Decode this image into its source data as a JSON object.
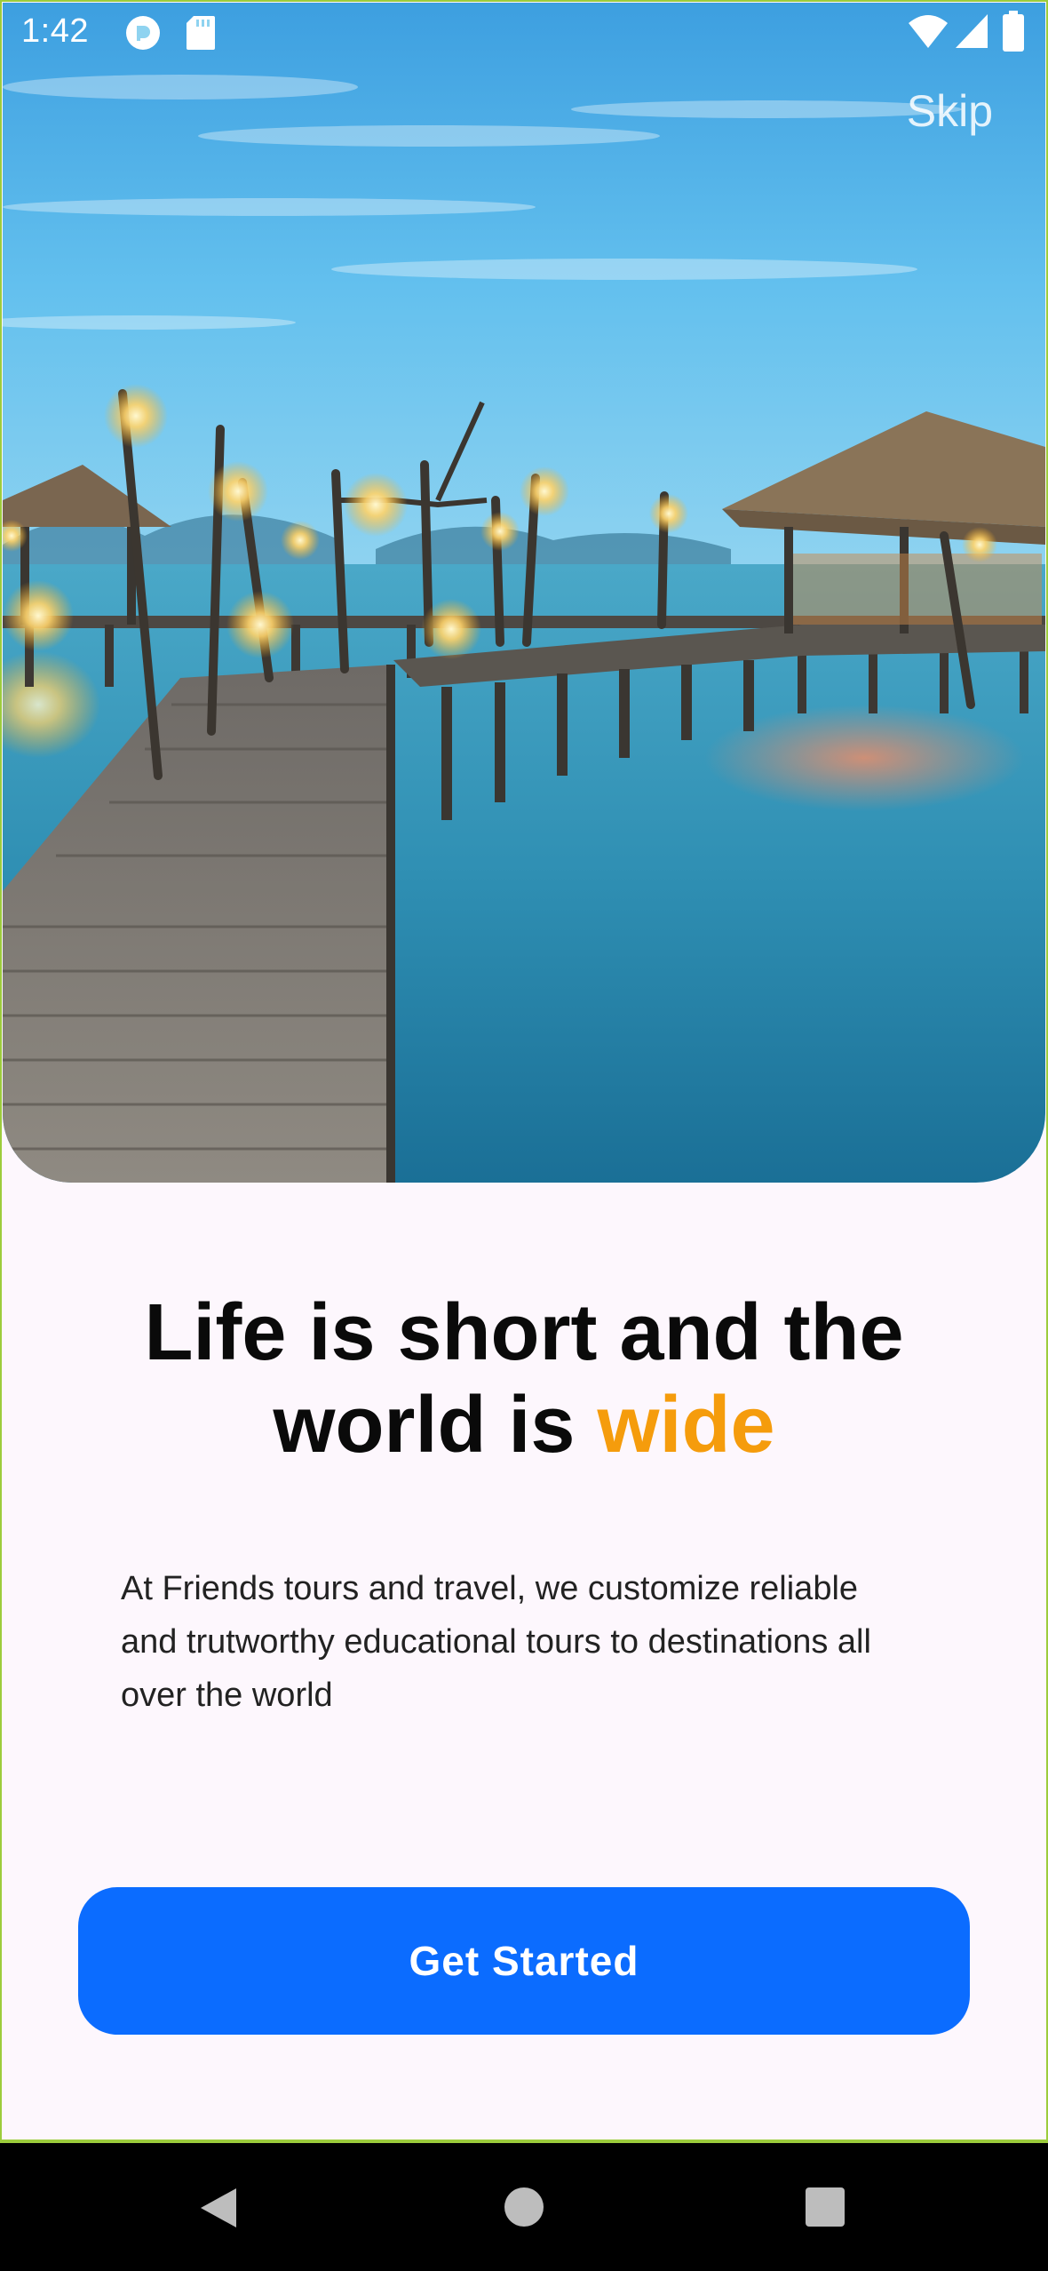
{
  "status_bar": {
    "time": "1:42",
    "icons": [
      "app-notification-icon",
      "sd-card-icon",
      "wifi-icon",
      "signal-icon",
      "battery-icon"
    ]
  },
  "header": {
    "skip_label": "Skip"
  },
  "hero": {
    "image_subject": "wooden pier leading to thatched huts over water at dusk with string lights"
  },
  "content": {
    "headline_line1": "Life is short and the",
    "headline_line2_prefix": "world is ",
    "headline_accent": "wide",
    "description": "At Friends tours and travel, we customize reliable and trutworthy educational tours to destinations all over the world"
  },
  "actions": {
    "get_started_label": "Get Started"
  },
  "navigation": {
    "buttons": [
      "back-icon",
      "home-icon",
      "recents-icon"
    ]
  },
  "colors": {
    "accent": "#f59c0c",
    "primary_button": "#0b6cff",
    "background": "#fdf7fd",
    "frame_border": "#9ccc3c"
  }
}
